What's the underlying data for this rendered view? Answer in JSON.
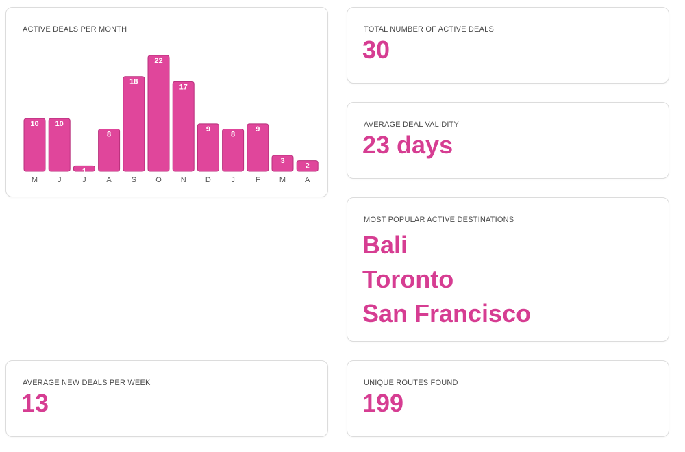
{
  "accent_color": "#d63d92",
  "bar_color": "#e0469b",
  "active_deals_chart": {
    "label": "ACTIVE DEALS PER MONTH"
  },
  "chart_data": {
    "type": "bar",
    "title": "ACTIVE DEALS PER MONTH",
    "categories": [
      "M",
      "J",
      "J",
      "A",
      "S",
      "O",
      "N",
      "D",
      "J",
      "F",
      "M",
      "A"
    ],
    "values": [
      10,
      10,
      1,
      8,
      18,
      22,
      17,
      9,
      8,
      9,
      3,
      2
    ],
    "xlabel": "",
    "ylabel": "",
    "ylim": [
      0,
      22
    ],
    "grid": false,
    "data_labels": true
  },
  "total_active_deals": {
    "label": "TOTAL NUMBER OF ACTIVE DEALS",
    "value": "30"
  },
  "average_deal_validity": {
    "label": "AVERAGE DEAL VALIDITY",
    "value": "23 days"
  },
  "popular_destinations": {
    "label": "MOST POPULAR ACTIVE DESTINATIONS",
    "items": [
      "Bali",
      "Toronto",
      "San Francisco"
    ]
  },
  "average_new_deals": {
    "label": "AVERAGE NEW DEALS PER WEEK",
    "value": "13"
  },
  "unique_routes": {
    "label": "UNIQUE ROUTES FOUND",
    "value": "199"
  }
}
